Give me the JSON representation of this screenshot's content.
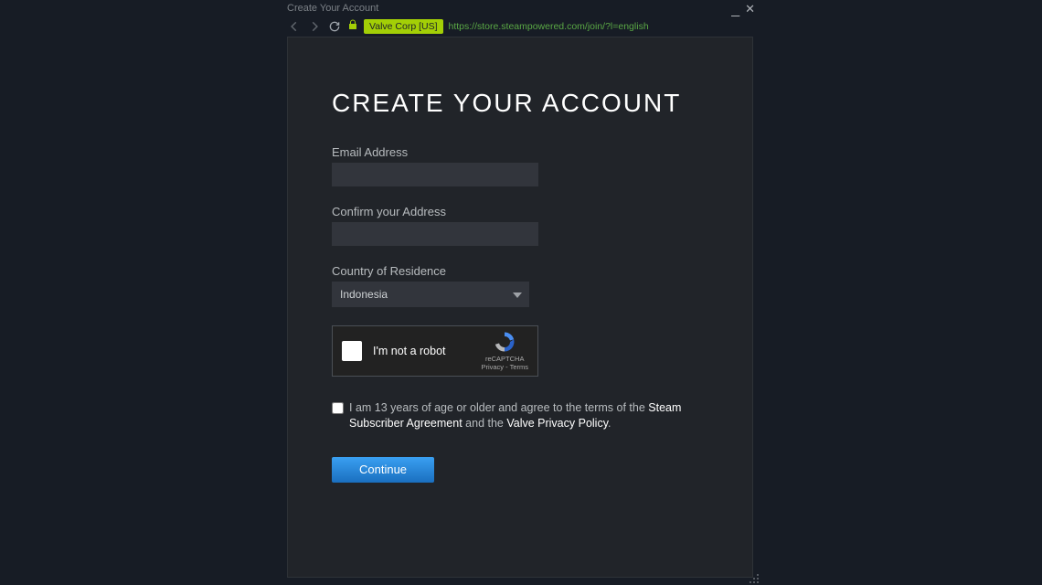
{
  "window": {
    "title": "Create Your Account"
  },
  "addressbar": {
    "cert": "Valve Corp [US]",
    "url": "https://store.steampowered.com/join/?l=english"
  },
  "page": {
    "heading": "CREATE YOUR ACCOUNT",
    "email_label": "Email Address",
    "email_value": "",
    "confirm_label": "Confirm your Address",
    "confirm_value": "",
    "country_label": "Country of Residence",
    "country_value": "Indonesia",
    "captcha_label": "I'm not a robot",
    "captcha_brand": "reCAPTCHA",
    "captcha_legal": "Privacy - Terms",
    "agree_prefix": "I am 13 years of age or older and agree to the terms of the ",
    "agree_link1": "Steam Subscriber Agreement",
    "agree_mid": " and the ",
    "agree_link2": "Valve Privacy Policy",
    "agree_suffix": ".",
    "continue_label": "Continue"
  }
}
